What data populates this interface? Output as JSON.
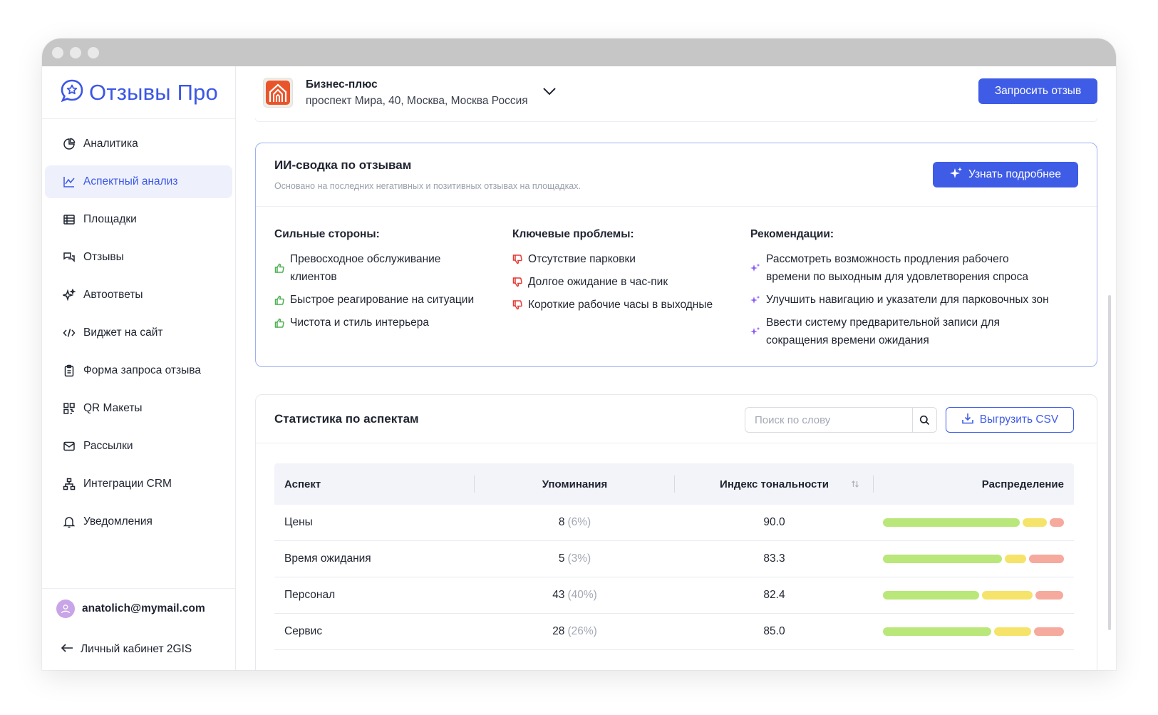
{
  "app": {
    "logo_text": "Отзывы Про"
  },
  "sidebar": {
    "items": [
      {
        "label": "Аналитика",
        "icon": "pie-chart-icon"
      },
      {
        "label": "Аспектный анализ",
        "icon": "line-chart-icon",
        "active": true
      },
      {
        "label": "Площадки",
        "icon": "table-icon"
      },
      {
        "label": "Отзывы",
        "icon": "chat-bubbles-icon"
      },
      {
        "label": "Автоответы",
        "icon": "sparkles-icon"
      },
      {
        "label": "Виджет на сайт",
        "icon": "code-icon"
      },
      {
        "label": "Форма запроса отзыва",
        "icon": "clipboard-icon"
      },
      {
        "label": "QR Макеты",
        "icon": "qr-code-icon"
      },
      {
        "label": "Рассылки",
        "icon": "mail-icon"
      },
      {
        "label": "Интеграции CRM",
        "icon": "hierarchy-icon"
      },
      {
        "label": "Уведомления",
        "icon": "bell-icon"
      }
    ],
    "user_email": "anatolich@mymail.com",
    "back_link": "Личный кабинет 2GIS"
  },
  "header": {
    "business_name": "Бизнес-плюс",
    "business_address": "проспект Мира, 40, Москва, Москва Россия",
    "request_button": "Запросить отзыв"
  },
  "ai_summary": {
    "title": "ИИ-сводка по отзывам",
    "subtitle": "Основано на последних негативных и позитивных отзывах на площадках.",
    "more_button": "Узнать подробнее",
    "strengths_title": "Сильные стороны:",
    "strengths": [
      "Превосходное обслуживание клиентов",
      "Быстрое реагирование на ситуации",
      "Чистота и стиль интерьера"
    ],
    "problems_title": "Ключевые проблемы:",
    "problems": [
      "Отсутствие парковки",
      "Долгое ожидание в час-пик",
      "Короткие рабочие часы в выходные"
    ],
    "recs_title": "Рекомендации:",
    "recommendations": [
      "Рассмотреть возможность продления рабочего времени по выходным для удовлетворения спроса",
      "Улучшить навигацию и указатели для парковочных зон",
      "Ввести систему предварительной записи для сокращения времени ожидания"
    ]
  },
  "stats": {
    "title": "Статистика по аспектам",
    "search_placeholder": "Поиск по слову",
    "csv_button": "Выгрузить CSV",
    "columns": {
      "aspect": "Аспект",
      "mentions": "Упоминания",
      "tonality": "Индекс тональности",
      "distribution": "Распределение"
    },
    "rows": [
      {
        "aspect": "Цены",
        "mentions": "8",
        "pct": "(6%)",
        "tonality": "90.0",
        "dist": [
          0.78,
          0.14,
          0.08
        ]
      },
      {
        "aspect": "Время ожидания",
        "mentions": "5",
        "pct": "(3%)",
        "tonality": "83.3",
        "dist": [
          0.68,
          0.12,
          0.2
        ]
      },
      {
        "aspect": "Персонал",
        "mentions": "43",
        "pct": "(40%)",
        "tonality": "82.4",
        "dist": [
          0.55,
          0.29,
          0.16
        ]
      },
      {
        "aspect": "Сервис",
        "mentions": "28",
        "pct": "(26%)",
        "tonality": "85.0",
        "dist": [
          0.62,
          0.21,
          0.17
        ]
      }
    ]
  },
  "colors": {
    "accent": "#3f5ce6",
    "positive": "#b9e779",
    "neutral": "#f5e36a",
    "negative": "#f6a99d",
    "thumb_up": "#4caf50",
    "thumb_down": "#e53935",
    "sparkle": "#8b5cf6"
  }
}
